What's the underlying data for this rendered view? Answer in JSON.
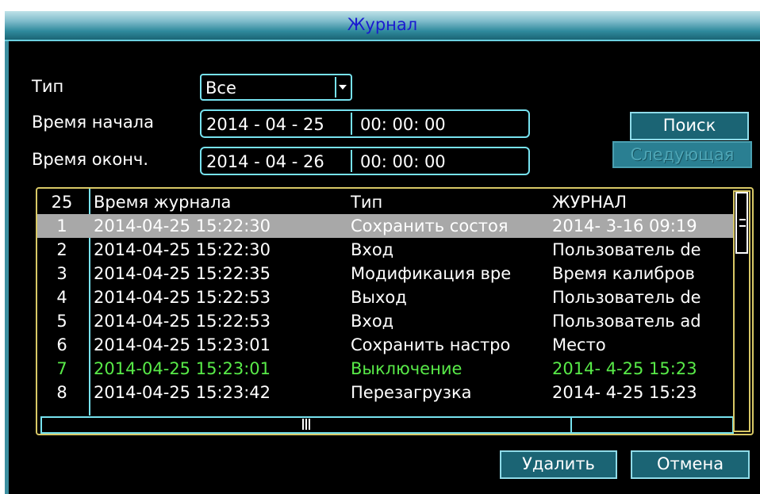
{
  "window": {
    "title": "Журнал"
  },
  "filters": {
    "type_label": "Тип",
    "type_value": "Все",
    "start_label": "Время начала",
    "start_date": "2014 - 04 - 25",
    "start_time": "00: 00: 00",
    "end_label": "Время оконч.",
    "end_date": "2014 - 04 - 26",
    "end_time": "00: 00: 00"
  },
  "buttons": {
    "search": "Поиск",
    "next": "Следующая",
    "delete": "Удалить",
    "cancel": "Отмена"
  },
  "table": {
    "headers": {
      "num": "25",
      "time": "Время журнала",
      "type": "Тип",
      "log": "ЖУРНАЛ"
    },
    "rows": [
      {
        "num": "1",
        "time": "2014-04-25 15:22:30",
        "type": "Сохранить состоя",
        "log": "2014- 3-16 09:19",
        "state": "selected"
      },
      {
        "num": "2",
        "time": "2014-04-25 15:22:30",
        "type": "Вход",
        "log": "Пользователь de",
        "state": "normal"
      },
      {
        "num": "3",
        "time": "2014-04-25 15:22:35",
        "type": "Модификация вре",
        "log": "Время калибров",
        "state": "normal"
      },
      {
        "num": "4",
        "time": "2014-04-25 15:22:53",
        "type": "Выход",
        "log": "Пользователь de",
        "state": "normal"
      },
      {
        "num": "5",
        "time": "2014-04-25 15:22:53",
        "type": "Вход",
        "log": "Пользователь ad",
        "state": "normal"
      },
      {
        "num": "6",
        "time": "2014-04-25 15:23:01",
        "type": "Сохранить настро",
        "log": "Место",
        "state": "normal"
      },
      {
        "num": "7",
        "time": "2014-04-25 15:23:01",
        "type": "Выключение",
        "log": "2014- 4-25 15:23",
        "state": "highlight"
      },
      {
        "num": "8",
        "time": "2014-04-25 15:23:42",
        "type": "Перезагрузка",
        "log": "2014- 4-25 15:23",
        "state": "normal"
      }
    ]
  },
  "colors": {
    "accent": "#77e2ef",
    "table_border": "#d8c866",
    "highlight_text": "#58ea48",
    "selected_row": "#a8a8a8"
  }
}
